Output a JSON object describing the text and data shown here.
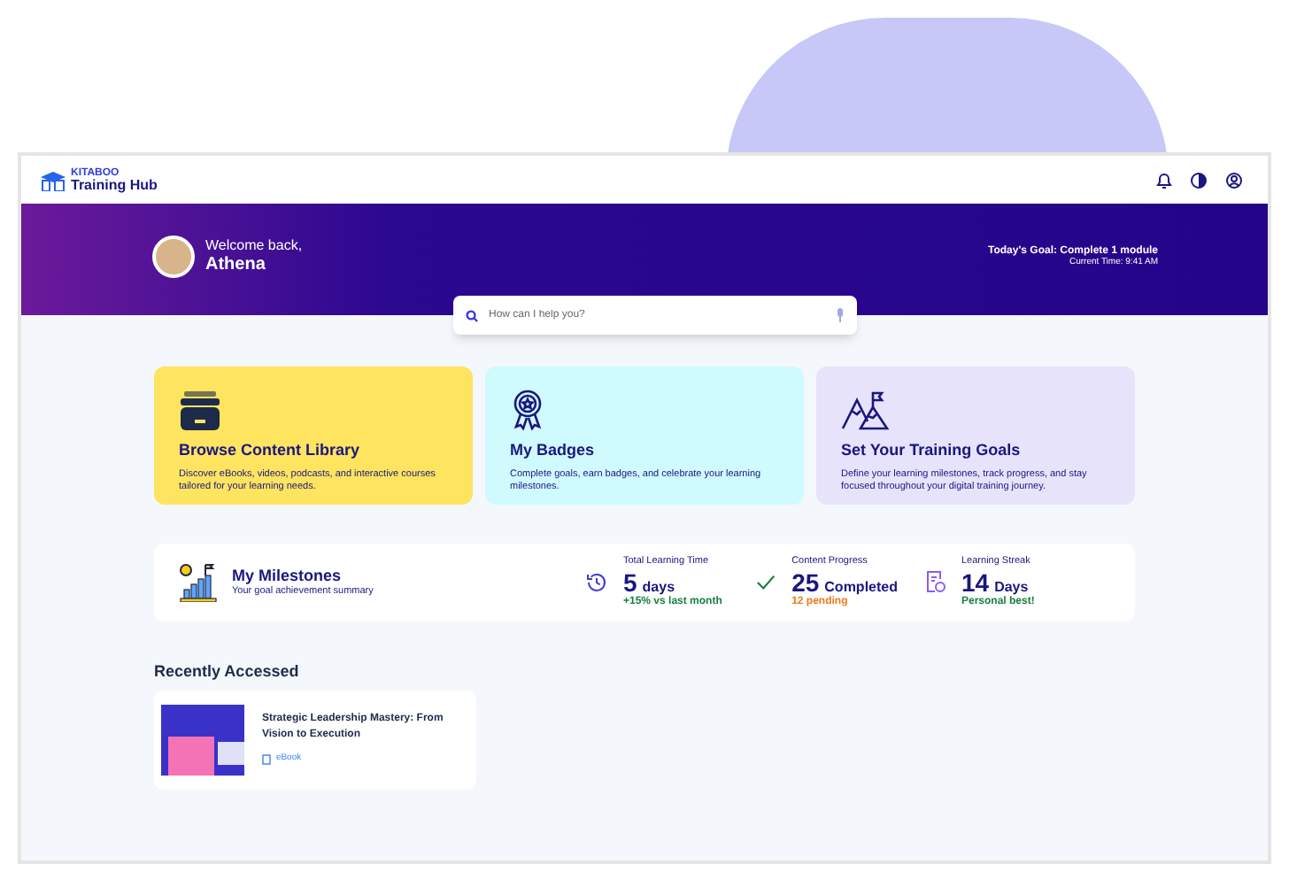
{
  "header": {
    "logo_line1": "KITABOO",
    "logo_line2": "Training Hub"
  },
  "banner": {
    "greeting": "Welcome back,",
    "name": "Athena",
    "goal": "Today's Goal: Complete 1 module",
    "time": "Current Time: 9:41 AM"
  },
  "search": {
    "placeholder": "How can I help you?"
  },
  "cards": [
    {
      "kind": "library",
      "title": "Browse Content Library",
      "text": "Discover eBooks, videos, podcasts, and interactive courses tailored for your learning needs.",
      "color": "#fee45f"
    },
    {
      "kind": "badges",
      "title": "My Badges",
      "text": "Complete goals, earn badges, and celebrate your learning milestones.",
      "color": "#cffafe"
    },
    {
      "kind": "goals",
      "title": "Set Your Training Goals",
      "text": "Define your learning milestones, track progress, and stay focused throughout your digital training journey.",
      "color": "#e6e3fb"
    }
  ],
  "milestones": {
    "title": "My Milestones",
    "subtitle": "Your goal achievement summary",
    "stats": [
      {
        "kind": "time",
        "label": "Total Learning Time",
        "value": "5",
        "unit": "days",
        "note": "+15% vs last month",
        "color": "#15803d"
      },
      {
        "kind": "progress",
        "label": "Content Progress",
        "value": "25",
        "unit": "Completed",
        "note": "12 pending",
        "color": "#ea7a1a"
      },
      {
        "kind": "streak",
        "label": "Learning Streak",
        "value": "14",
        "unit": "Days",
        "note": "Personal best!",
        "color": "#15803d"
      }
    ]
  },
  "recent": {
    "title": "Recently Accessed",
    "items": [
      {
        "title": "Strategic Leadership Mastery: From Vision to Execution",
        "type": "eBook"
      }
    ]
  }
}
